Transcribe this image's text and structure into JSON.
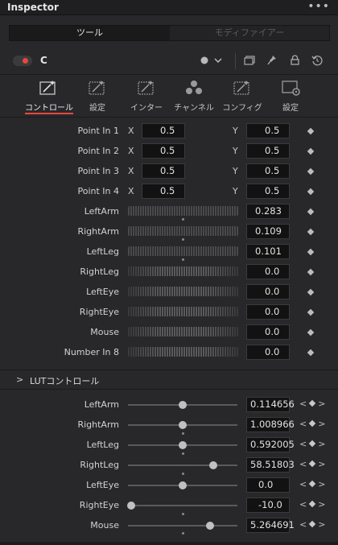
{
  "window": {
    "title": "Inspector",
    "more_icon": "more-dots-icon"
  },
  "segment": {
    "active": "ツール",
    "inactive": "モディファイアー"
  },
  "node": {
    "name": "C",
    "enabled_color": "#e5483c"
  },
  "header_icons": [
    "color-dot-icon",
    "chevron-down-icon",
    "copy-tool-icon",
    "pin-icon",
    "lock-icon",
    "reset-icon"
  ],
  "tool_tabs": [
    {
      "label": "コントロール",
      "icon": "wand-icon",
      "active": true
    },
    {
      "label": "設定",
      "icon": "wand-icon",
      "active": false
    },
    {
      "label": "インター",
      "icon": "wand-icon",
      "active": false
    },
    {
      "label": "チャンネル",
      "icon": "channels-icon",
      "active": false
    },
    {
      "label": "コンフィグ",
      "icon": "wand-icon",
      "active": false
    },
    {
      "label": "設定",
      "icon": "settings-gear-icon",
      "active": false
    }
  ],
  "points": [
    {
      "label": "Point In 1",
      "x_axis": "X",
      "x": "0.5",
      "y_axis": "Y",
      "y": "0.5"
    },
    {
      "label": "Point In 2",
      "x_axis": "X",
      "x": "0.5",
      "y_axis": "Y",
      "y": "0.5"
    },
    {
      "label": "Point In 3",
      "x_axis": "X",
      "x": "0.5",
      "y_axis": "Y",
      "y": "0.5"
    },
    {
      "label": "Point In 4",
      "x_axis": "X",
      "x": "0.5",
      "y_axis": "Y",
      "y": "0.5"
    }
  ],
  "wheels": [
    {
      "label": "LeftArm",
      "value": "0.283"
    },
    {
      "label": "RightArm",
      "value": "0.109"
    },
    {
      "label": "LeftLeg",
      "value": "0.101"
    },
    {
      "label": "RightLeg",
      "value": "0.0"
    },
    {
      "label": "LeftEye",
      "value": "0.0"
    },
    {
      "label": "RightEye",
      "value": "0.0"
    },
    {
      "label": "Mouse",
      "value": "0.0"
    },
    {
      "label": "Number In 8",
      "value": "0.0"
    }
  ],
  "section": {
    "title": "LUTコントロール"
  },
  "sliders": [
    {
      "label": "LeftArm",
      "value": "0.114656",
      "level": 0.5
    },
    {
      "label": "RightArm",
      "value": "1.008966",
      "level": 0.5
    },
    {
      "label": "LeftLeg",
      "value": "0.592005",
      "level": 0.5
    },
    {
      "label": "RightLeg",
      "value": "58.51803",
      "level": 0.78
    },
    {
      "label": "LeftEye",
      "value": "0.0",
      "level": 0.5
    },
    {
      "label": "RightEye",
      "value": "-10.0",
      "level": 0.0
    },
    {
      "label": "Mouse",
      "value": "5.264691",
      "level": 0.75
    }
  ]
}
